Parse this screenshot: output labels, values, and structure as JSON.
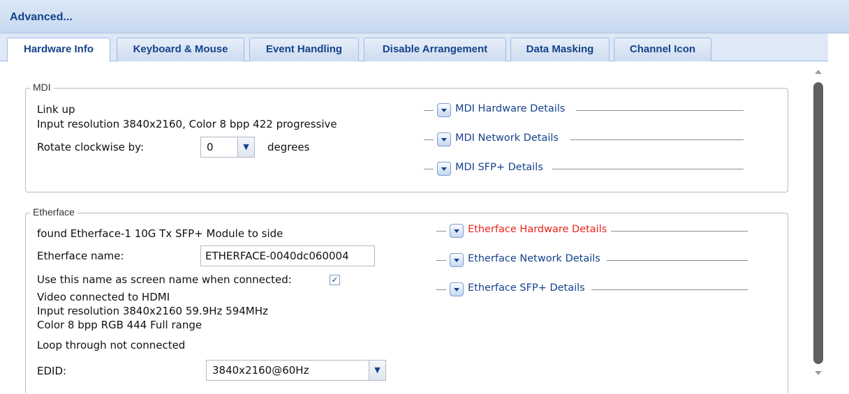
{
  "window": {
    "title": "Advanced..."
  },
  "tabs": [
    {
      "label": "Hardware Info",
      "active": true
    },
    {
      "label": "Keyboard & Mouse"
    },
    {
      "label": "Event Handling"
    },
    {
      "label": "Disable Arrangement"
    },
    {
      "label": "Data Masking"
    },
    {
      "label": "Channel Icon"
    }
  ],
  "mdi": {
    "legend": "MDI",
    "status": "Link up",
    "input_resolution": "Input resolution 3840x2160, Color 8 bpp 422 progressive",
    "rotate_label": "Rotate clockwise by:",
    "rotate_value": "0",
    "rotate_unit": "degrees",
    "details": [
      "MDI Hardware Details",
      "MDI Network Details",
      "MDI SFP+ Details"
    ]
  },
  "etherface": {
    "legend": "Etherface",
    "found": "found Etherface-1 10G Tx SFP+ Module to side",
    "name_label": "Etherface name:",
    "name_value": "ETHERFACE-0040dc060004",
    "use_name_label": "Use this name as screen name when connected:",
    "use_name_checked": true,
    "video": "Video connected to HDMI",
    "input_resolution": "Input resolution 3840x2160 59.9Hz 594MHz",
    "color": "Color 8 bpp RGB 444 Full range",
    "loop": "Loop through not connected",
    "edid_label": "EDID:",
    "edid_value": "3840x2160@60Hz",
    "details": [
      "Etherface Hardware Details",
      "Etherface Network Details",
      "Etherface SFP+ Details"
    ]
  },
  "colors": {
    "accent": "#15428b",
    "highlight": "#e8221b"
  },
  "icons": {
    "dropdown": "chevron-down-icon",
    "expand": "expand-down-icon",
    "check": "check-icon"
  }
}
